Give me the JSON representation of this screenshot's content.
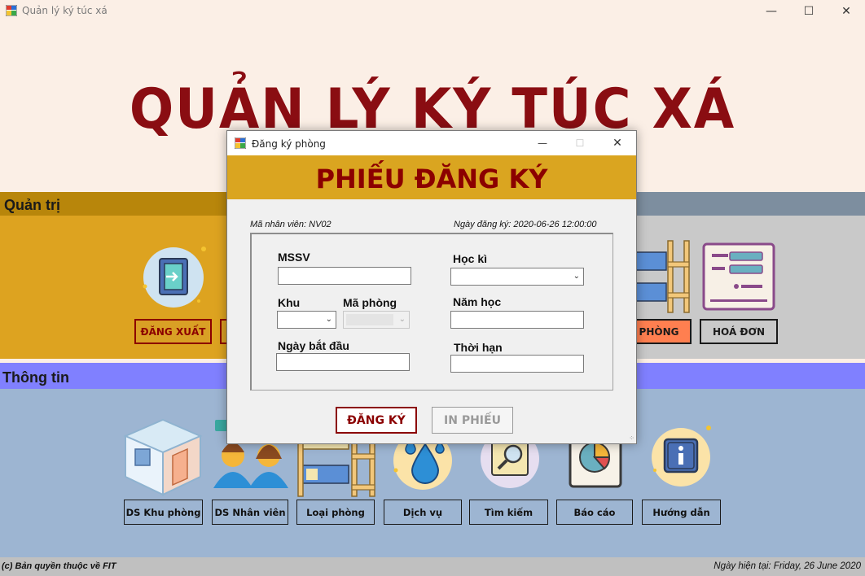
{
  "window": {
    "title": "Quản lý ký túc xá",
    "minimize": "—",
    "maximize": "☐",
    "close": "✕"
  },
  "main_title": "QUẢN LÝ KÝ TÚC XÁ",
  "admin": {
    "label": "Quản trị",
    "buttons": {
      "logout": "ĐĂNG XUẤT",
      "room": "PHÒNG",
      "invoice": "HOÁ ĐƠN"
    }
  },
  "info": {
    "label": "Thông tin",
    "buttons": {
      "ds_khu_phong": "DS Khu phòng",
      "ds_nhan_vien": "DS Nhân viên",
      "loai_phong": "Loại phòng",
      "dich_vu": "Dịch vụ",
      "tim_kiem": "Tìm kiếm",
      "bao_cao": "Báo cáo",
      "huong_dan": "Hướng dẫn"
    }
  },
  "footer": {
    "copyright": "(c) Bản quyền thuộc về FIT",
    "date": "Ngày hiện tại: Friday, 26 June 2020"
  },
  "dialog": {
    "title": "Đăng ký phòng",
    "minimize": "—",
    "maximize": "☐",
    "close": "✕",
    "banner": "PHIẾU ĐĂNG KÝ",
    "staff_id": "Mã nhân viên: NV02",
    "reg_date": "Ngày đăng ký: 2020-06-26 12:00:00",
    "fields": {
      "mssv": "MSSV",
      "hoc_ki": "Học kì",
      "khu": "Khu",
      "ma_phong": "Mã phòng",
      "nam_hoc": "Năm học",
      "ngay_bat_dau": "Ngày bắt đầu",
      "thoi_han": "Thời hạn"
    },
    "btn_register": "ĐĂNG KÝ",
    "btn_print": "IN PHIẾU"
  },
  "colors": {
    "title_red": "#8a0d12",
    "gold": "#daa520",
    "admin_bg": "#dda320",
    "info_head": "#8080ff",
    "info_bg": "#9db5d2"
  }
}
